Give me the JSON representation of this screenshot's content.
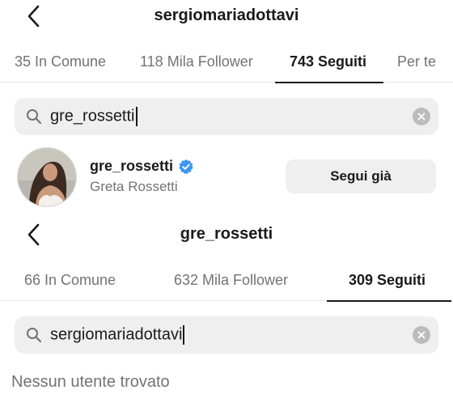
{
  "top": {
    "title": "sergiomariadottavi",
    "tabs": [
      {
        "label": "35 In Comune",
        "active": false
      },
      {
        "label": "118 Mila Follower",
        "active": false
      },
      {
        "label": "743 Seguiti",
        "active": true
      },
      {
        "label": "Per te",
        "active": false
      }
    ],
    "search_value": "gre_rossetti",
    "result": {
      "username": "gre_rossetti",
      "full_name": "Greta Rossetti",
      "verified": true,
      "button_label": "Segui già"
    }
  },
  "bottom": {
    "title": "gre_rossetti",
    "tabs": [
      {
        "label": "66 In Comune",
        "active": false
      },
      {
        "label": "632 Mila Follower",
        "active": false
      },
      {
        "label": "309 Seguiti",
        "active": true
      }
    ],
    "search_value": "sergiomariadottavi",
    "empty_message": "Nessun utente trovato"
  },
  "colors": {
    "verified": "#3897f0",
    "muted_text": "#737373",
    "field_bg": "#efefef"
  },
  "icons": [
    "back-arrow-icon",
    "search-icon",
    "clear-icon",
    "verified-badge-icon"
  ]
}
